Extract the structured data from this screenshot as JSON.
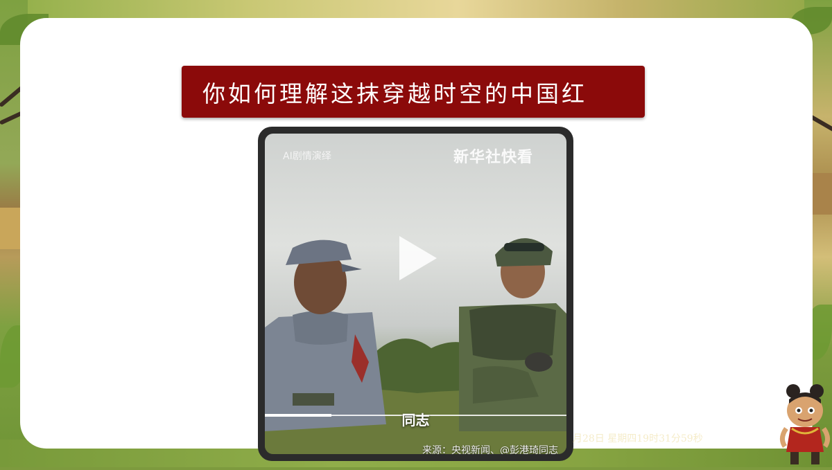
{
  "slide": {
    "title": "你如何理解这抹穿越时空的中国红"
  },
  "video": {
    "ai_tag": "AI剧情演绎",
    "brand": "新华社快看",
    "subtitle": "同志",
    "source": "来源：央视新闻、@彭港琦同志",
    "progress": 0.22
  },
  "footer": {
    "datetime": "月28日 星期四19时31分59秒"
  },
  "colors": {
    "banner": "#8b0a0a",
    "card": "#ffffff",
    "device_frame": "#2b2b2b"
  },
  "icons": {
    "play": "play-icon",
    "mascot": "mascot-character-icon"
  }
}
